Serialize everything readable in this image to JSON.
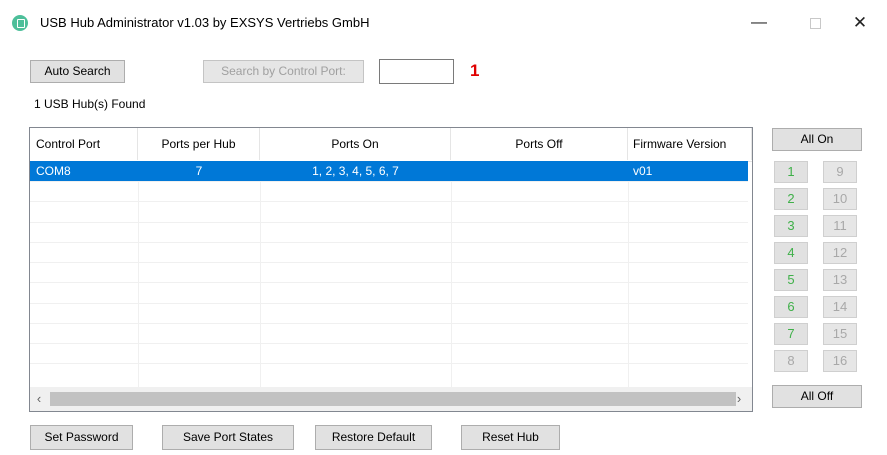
{
  "window": {
    "title": "USB Hub Administrator v1.03 by EXSYS Vertriebs GmbH",
    "minimize_glyph": "—",
    "close_glyph": "✕"
  },
  "toolbar": {
    "auto_search_label": "Auto Search",
    "search_by_port_label": "Search by Control Port:",
    "port_input_value": "",
    "marker_text": "1"
  },
  "status": {
    "hubs_found": "1 USB Hub(s) Found"
  },
  "table": {
    "columns": [
      "Control Port",
      "Ports per Hub",
      "Ports On",
      "Ports Off",
      "Firmware Version"
    ],
    "rows": [
      {
        "control_port": "COM8",
        "ports_per_hub": "7",
        "ports_on": "1, 2, 3, 4, 5, 6, 7",
        "ports_off": "",
        "firmware": "v01"
      }
    ]
  },
  "scrollbar": {
    "left_arrow": "‹",
    "right_arrow": "›"
  },
  "ports": {
    "all_on_label": "All On",
    "all_off_label": "All Off",
    "buttons": [
      "1",
      "2",
      "3",
      "4",
      "5",
      "6",
      "7",
      "8",
      "9",
      "10",
      "11",
      "12",
      "13",
      "14",
      "15",
      "16"
    ]
  },
  "bottom": {
    "set_password_label": "Set Password",
    "save_port_states_label": "Save Port States",
    "restore_default_label": "Restore Default",
    "reset_hub_label": "Reset Hub"
  },
  "colors": {
    "selection": "#0078d7",
    "port_on": "#3fb049",
    "port_off": "#a8a8a8",
    "marker": "#e00000",
    "app_icon": "#4dbf9a"
  }
}
